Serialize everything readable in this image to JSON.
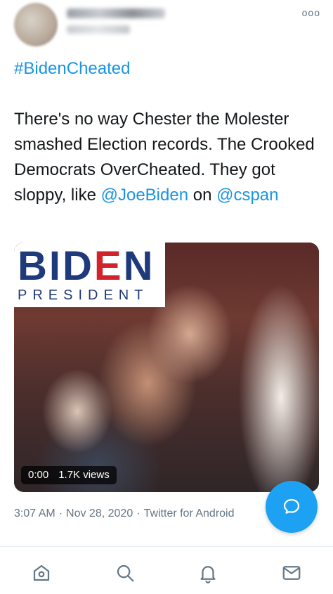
{
  "header": {
    "avatar_label": "avatar",
    "more_label": "ooo"
  },
  "tweet": {
    "hashtag": "#BidenCheated",
    "text_part1": "There's no way Chester the Molester smashed Election records. The Crooked Democrats OverCheated. They got sloppy, like ",
    "mention1": "@JoeBiden",
    "text_part2": " on ",
    "mention2": "@cspan"
  },
  "media": {
    "logo_top_left": "BID",
    "logo_e": "E",
    "logo_top_right": "N",
    "logo_bottom": "PRESIDENT",
    "video_time": "0:00",
    "video_views": "1.7K views"
  },
  "meta": {
    "time": "3:07 AM",
    "date": "Nov 28, 2020",
    "source": "Twitter for Android"
  },
  "nav": {
    "items": [
      "home-icon",
      "search-icon",
      "notifications-icon",
      "messages-icon"
    ]
  },
  "colors": {
    "accent": "#1da1f2",
    "link": "#1b95e0",
    "muted": "#657786"
  }
}
